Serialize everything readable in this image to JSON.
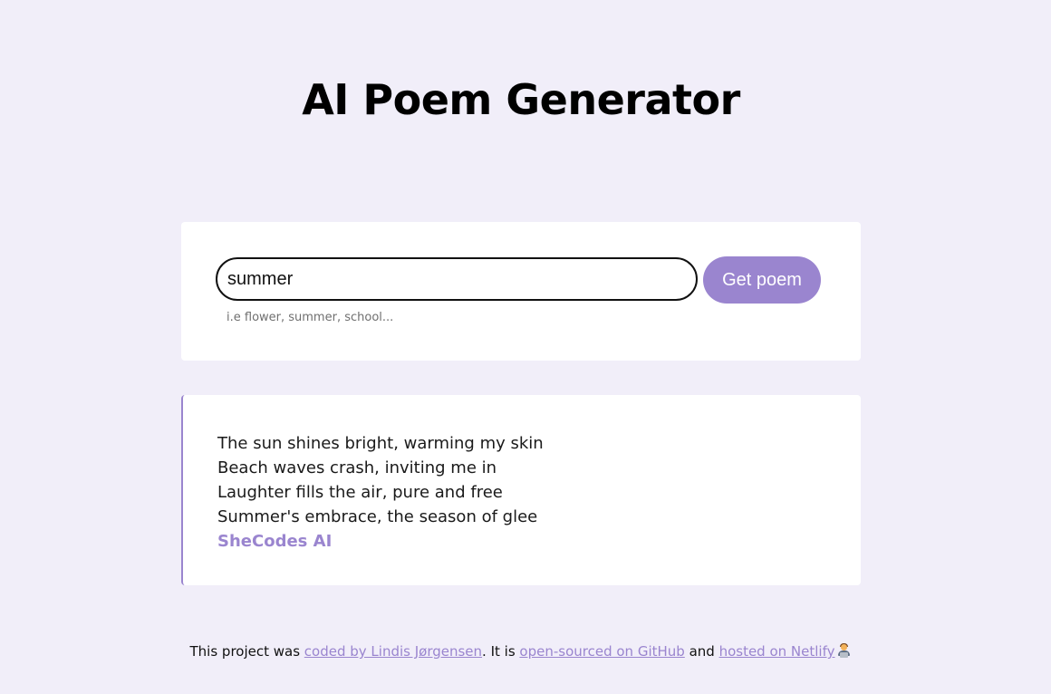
{
  "header": {
    "title": "AI Poem Generator"
  },
  "form": {
    "input_value": "summer",
    "hint": "i.e flower, summer, school...",
    "submit_label": "Get poem"
  },
  "poem": {
    "lines": [
      "The sun shines bright, warming my skin",
      "Beach waves crash, inviting me in",
      "Laughter fills the air, pure and free",
      "Summer's embrace, the season of glee"
    ],
    "signature": "SheCodes AI"
  },
  "footer": {
    "text_1": "This project was ",
    "link_author": "coded by Lindis Jørgensen",
    "text_2": ". It is ",
    "link_github": "open-sourced on GitHub",
    "text_3": " and ",
    "link_netlify": "hosted on Netlify",
    "emoji_icon": "technologist-icon"
  },
  "colors": {
    "background": "#f1eef9",
    "accent": "#9a85cf",
    "card": "#ffffff"
  }
}
